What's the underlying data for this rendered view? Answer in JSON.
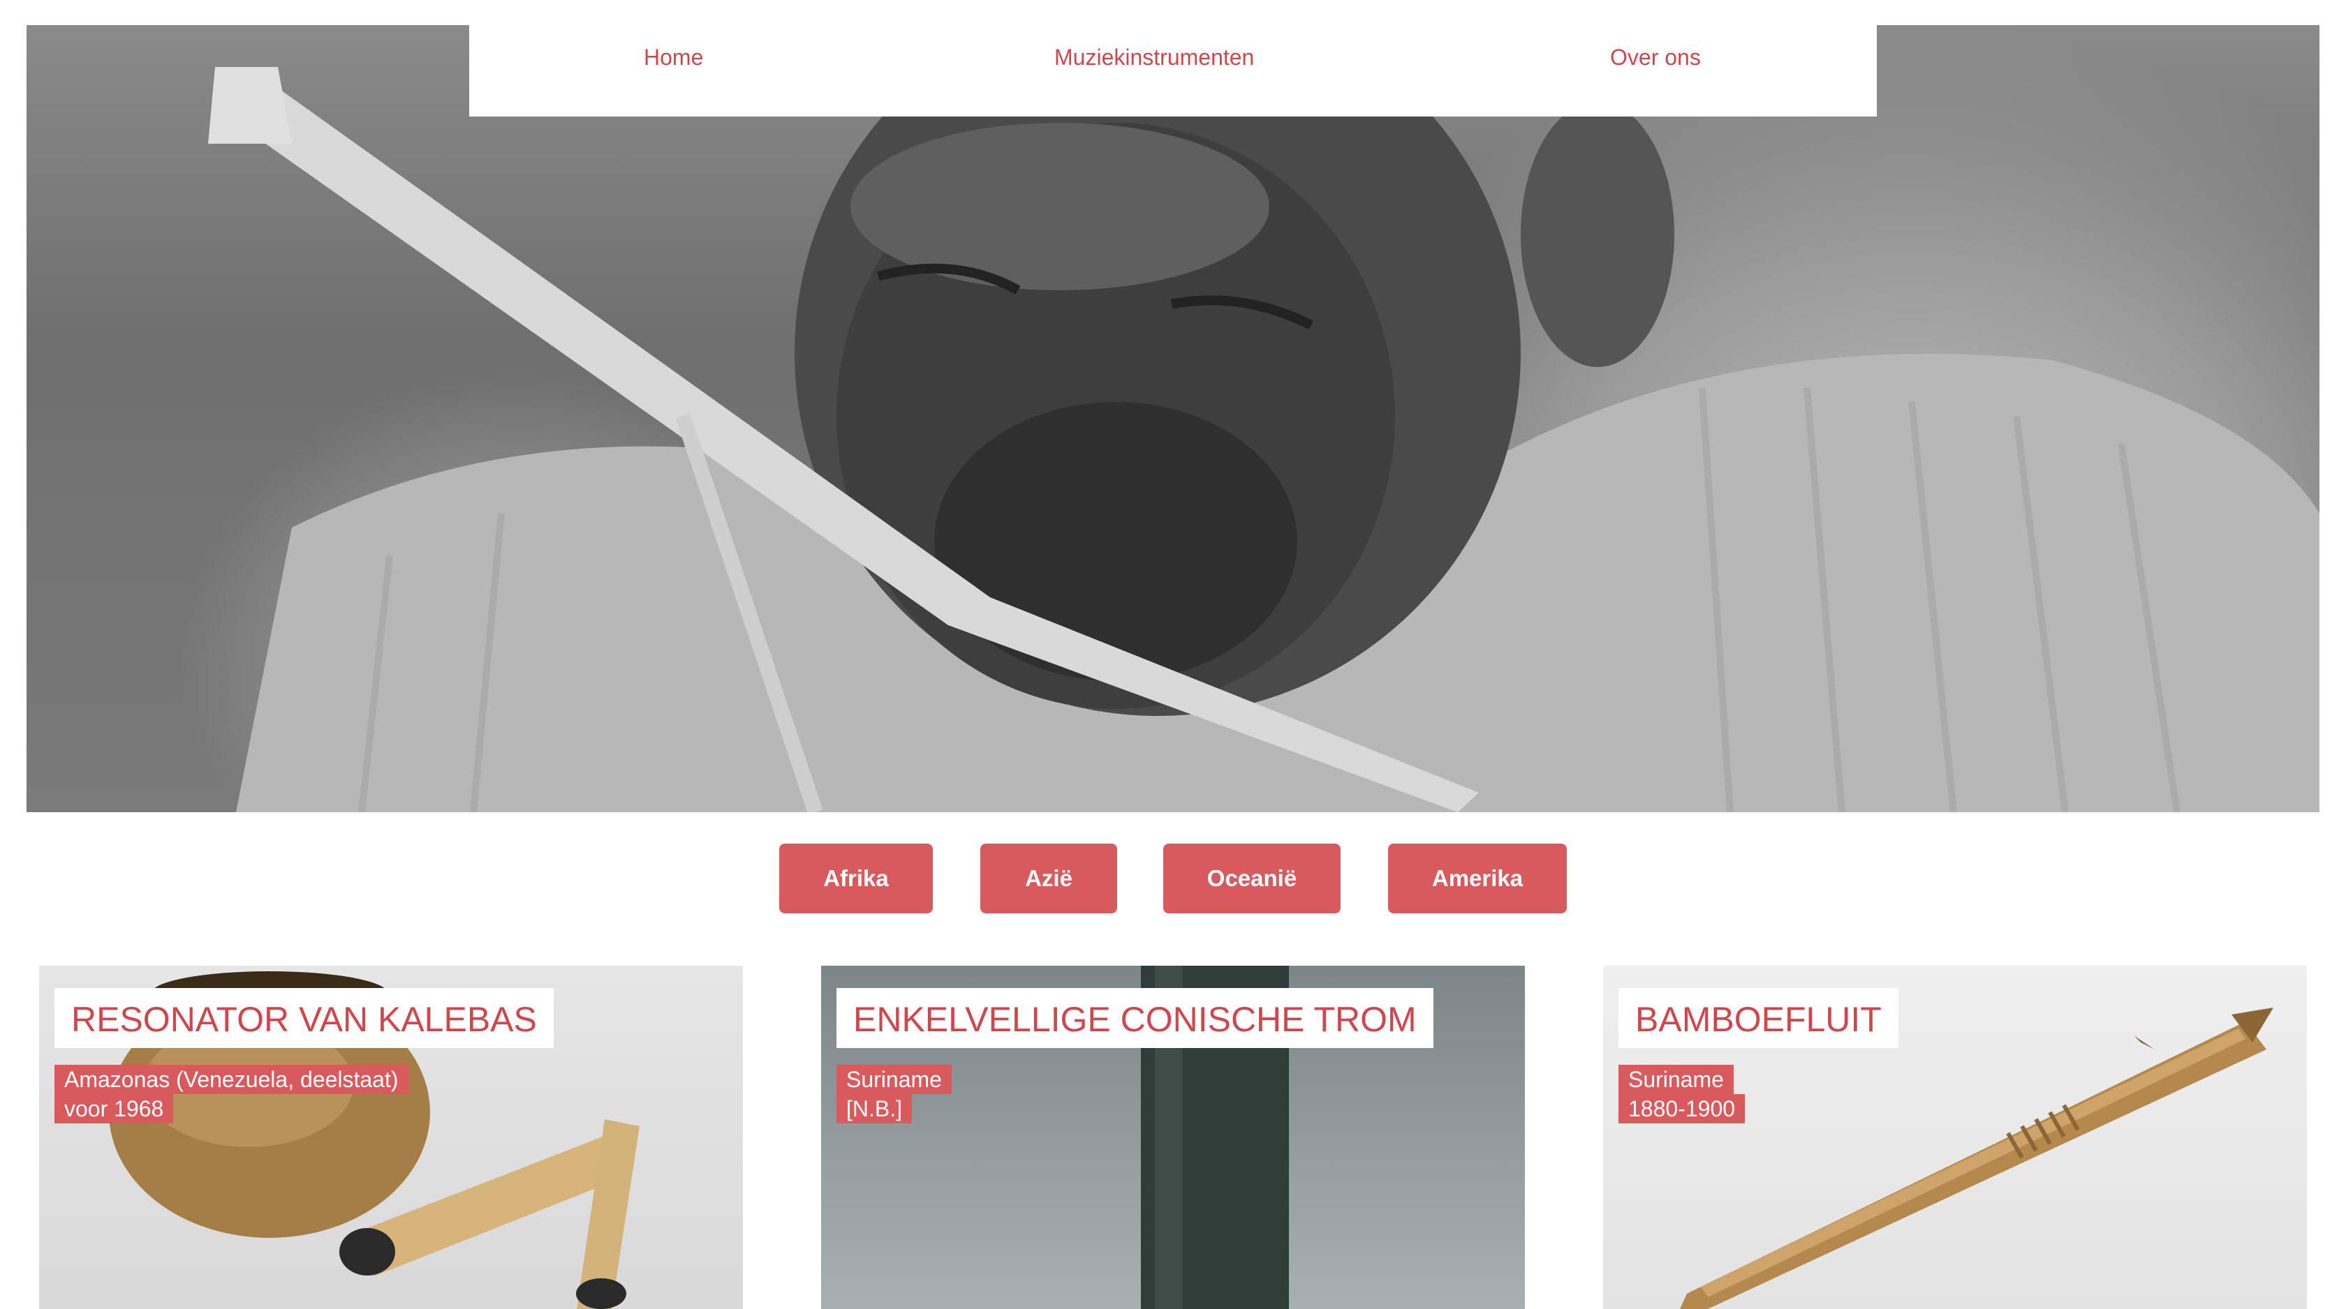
{
  "nav": {
    "items": [
      {
        "label": "Home"
      },
      {
        "label": "Muziekinstrumenten"
      },
      {
        "label": "Over ons"
      }
    ]
  },
  "regions": [
    {
      "label": "Afrika"
    },
    {
      "label": "Azië"
    },
    {
      "label": "Oceanië"
    },
    {
      "label": "Amerika"
    }
  ],
  "cards": [
    {
      "title": "RESONATOR VAN KALEBAS",
      "place": "Amazonas (Venezuela, deelstaat)",
      "date": "voor 1968"
    },
    {
      "title": "ENKELVELLIGE CONISCHE TROM",
      "place": "Suriname",
      "date": "[N.B.]"
    },
    {
      "title": "BAMBOEFLUIT",
      "place": "Suriname",
      "date": "1880-1900"
    }
  ],
  "colors": {
    "accent": "#d85a5c",
    "accent_text": "#d0464b"
  }
}
